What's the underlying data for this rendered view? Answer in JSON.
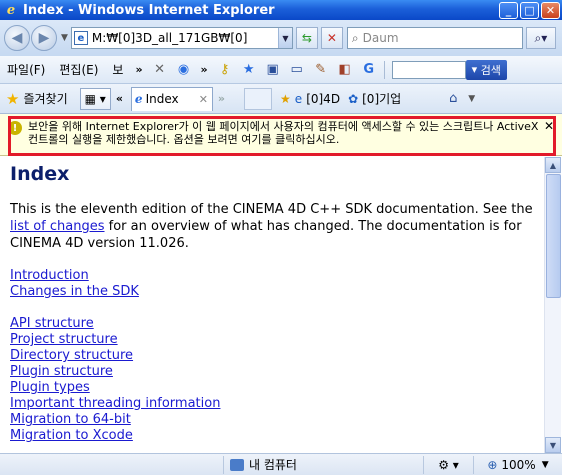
{
  "window": {
    "title": "Index - Windows Internet Explorer",
    "minimize": "_",
    "maximize": "□",
    "close": "✕"
  },
  "address_bar": {
    "url": "M:₩[0]3D_all_171GB₩[0]",
    "search_placeholder": "Daum"
  },
  "menu": {
    "items": [
      "파일(F)",
      "편집(E)",
      "보"
    ],
    "overflow": "»",
    "search_button": "검색"
  },
  "favorites": {
    "label": "즐겨찾기",
    "tab_label": "Index",
    "links": [
      "[0]4D",
      "[0]기업"
    ]
  },
  "infobar": {
    "message": "보안을 위해 Internet Explorer가 이 웹 페이지에서 사용자의 컴퓨터에 액세스할 수 있는 스크립트나 ActiveX 컨트롤의 실행을 제한했습니다. 옵션을 보려면 여기를 클릭하십시오."
  },
  "page": {
    "heading": "Index",
    "intro_before": "This is the eleventh edition of the CINEMA 4D C++ SDK documentation. See the ",
    "intro_link": "list of changes",
    "intro_after": " for an overview of what has changed. The documentation is for CINEMA 4D version 11.026.",
    "links_group1": [
      "Introduction",
      "Changes in the SDK"
    ],
    "links_group2": [
      "API structure",
      "Project structure",
      "Directory structure",
      "Plugin structure",
      "Plugin types",
      "Important threading information",
      "Migration to 64-bit",
      "Migration to Xcode"
    ]
  },
  "status": {
    "zone": "내 컴퓨터",
    "zoom": "100%"
  }
}
